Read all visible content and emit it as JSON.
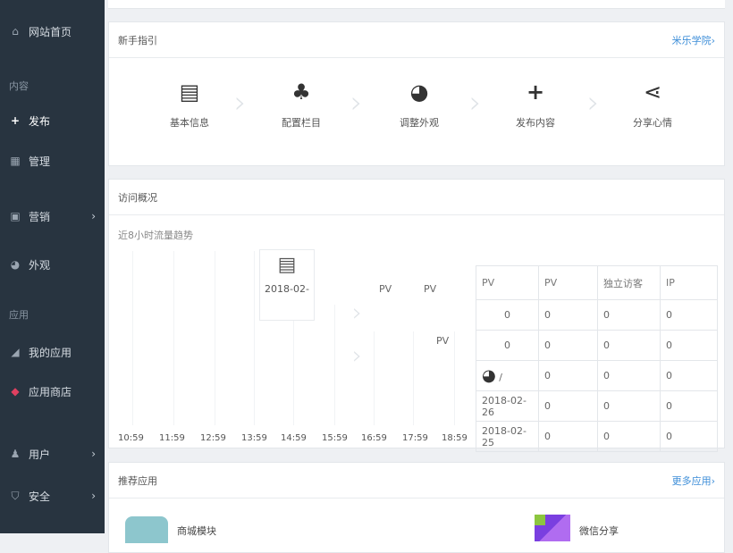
{
  "sidebar": {
    "home": {
      "icon": "home-icon",
      "label": "网站首页"
    },
    "section_content": "内容",
    "publish": {
      "icon": "plus-icon",
      "label": "发布"
    },
    "manage": {
      "icon": "grid-icon",
      "label": "管理"
    },
    "marketing": {
      "icon": "marketing-icon",
      "label": "营销"
    },
    "appearance": {
      "icon": "palette-icon",
      "label": "外观"
    },
    "section_apps": "应用",
    "my_apps": {
      "icon": "pin-icon",
      "label": "我的应用"
    },
    "app_store": {
      "icon": "box-icon",
      "label": "应用商店"
    },
    "users": {
      "icon": "user-icon",
      "label": "用户"
    },
    "security": {
      "icon": "shield-icon",
      "label": "安全"
    },
    "chevron": "›"
  },
  "guide": {
    "title": "新手指引",
    "more": "米乐学院›",
    "steps": [
      {
        "icon": "info-card-icon",
        "label": "基本信息"
      },
      {
        "icon": "sitemap-icon",
        "label": "配置栏目"
      },
      {
        "icon": "palette-icon",
        "label": "调整外观"
      },
      {
        "icon": "plus-icon",
        "label": "发布内容"
      },
      {
        "icon": "share-icon",
        "label": "分享心情"
      }
    ]
  },
  "stats": {
    "title": "访问概况",
    "chart_label": "近8小时流量趋势",
    "x_ticks": [
      "10:59",
      "11:59",
      "12:59",
      "13:59",
      "14:59",
      "15:59",
      "16:59",
      "17:59",
      "18:59"
    ],
    "floating_date": "2018-02-",
    "pv_labels": [
      "PV",
      "PV",
      "PV"
    ],
    "table_headers": [
      "PV",
      "PV",
      "独立访客",
      "IP"
    ],
    "rows": [
      {
        "date": "",
        "a": "0",
        "b": "0",
        "c": "0",
        "d": "0"
      },
      {
        "date": "",
        "a": "0",
        "b": "0",
        "c": "0",
        "d": "0"
      },
      {
        "date": "",
        "a": "/",
        "b": "0",
        "c": "0",
        "d": "0"
      },
      {
        "date": "2018-02-26",
        "a": "0",
        "b": "0",
        "c": "0",
        "d": ""
      },
      {
        "date": "2018-02-25",
        "a": "0",
        "b": "0",
        "c": "0",
        "d": ""
      }
    ]
  },
  "apps": {
    "title": "推荐应用",
    "more": "更多应用›",
    "items": [
      {
        "name": "商城模块"
      },
      {
        "name": "微信分享"
      }
    ]
  }
}
